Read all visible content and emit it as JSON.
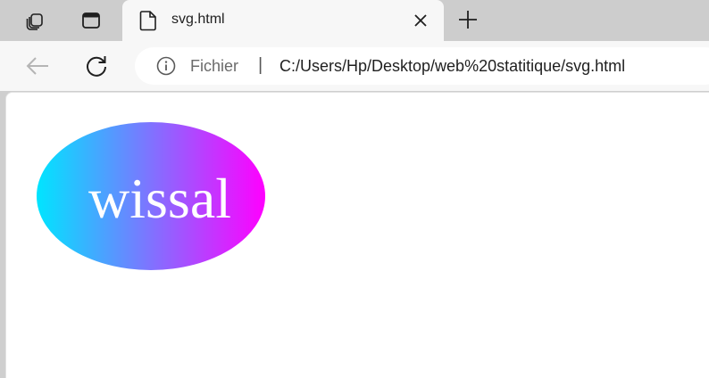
{
  "browser": {
    "tab": {
      "title": "svg.html"
    },
    "toolbar": {
      "address": {
        "scheme_label": "Fichier",
        "separator": "|",
        "url": "C:/Users/Hp/Desktop/web%20statitique/svg.html"
      }
    }
  },
  "page": {
    "ellipse_text": "wissal",
    "gradient": {
      "start_color": "#00e5ff",
      "end_color": "#ff00ff"
    },
    "text_color": "#ffffff"
  }
}
